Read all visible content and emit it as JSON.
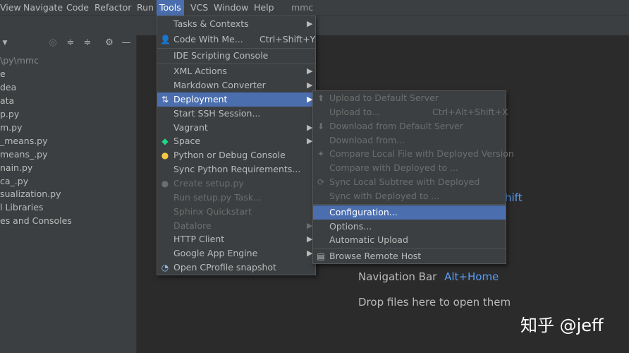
{
  "menubar": {
    "items": [
      "View",
      "Navigate",
      "Code",
      "Refactor",
      "Run",
      "Tools",
      "VCS",
      "Window",
      "Help"
    ],
    "project_name": "mmc"
  },
  "project_panel": {
    "path": "\\py\\mmc",
    "items": [
      "e",
      "dea",
      "ata",
      "p.py",
      "m.py",
      "_means.py",
      "means_.py",
      "nain.py",
      "ca_.py",
      "sualization.py",
      "l Libraries",
      "es and Consoles"
    ]
  },
  "editor_hints": {
    "hint1_suffix": "hift",
    "nav_label": "Navigation Bar",
    "nav_key": "Alt+Home",
    "drop_text": "Drop files here to open them"
  },
  "tools_menu": {
    "items": [
      {
        "label": "Tasks & Contexts",
        "submenu": true
      },
      {
        "label": "Code With Me...",
        "shortcut": "Ctrl+Shift+Y",
        "icon": "person-icon"
      },
      {
        "label": "IDE Scripting Console"
      },
      {
        "label": "XML Actions",
        "submenu": true
      },
      {
        "label": "Markdown Converter",
        "submenu": true
      },
      {
        "label": "Deployment",
        "submenu": true,
        "icon": "deployment-icon"
      },
      {
        "label": "Start SSH Session..."
      },
      {
        "label": "Vagrant",
        "submenu": true
      },
      {
        "label": "Space",
        "submenu": true,
        "icon": "space-icon"
      },
      {
        "label": "Python or Debug Console",
        "icon": "python-icon"
      },
      {
        "label": "Sync Python Requirements..."
      },
      {
        "label": "Create setup.py",
        "icon": "python-icon"
      },
      {
        "label": "Run setup.py Task..."
      },
      {
        "label": "Sphinx Quickstart"
      },
      {
        "label": "Datalore",
        "submenu": true
      },
      {
        "label": "HTTP Client",
        "submenu": true
      },
      {
        "label": "Google App Engine",
        "submenu": true
      },
      {
        "label": "Open CProfile snapshot",
        "icon": "profiler-icon"
      }
    ]
  },
  "deployment_menu": {
    "items": [
      {
        "label": "Upload to Default Server",
        "icon": "upload-icon"
      },
      {
        "label": "Upload to...",
        "shortcut": "Ctrl+Alt+Shift+X"
      },
      {
        "label": "Download from Default Server",
        "icon": "download-icon"
      },
      {
        "label": "Download from..."
      },
      {
        "label": "Compare Local File with Deployed Version",
        "icon": "compare-icon"
      },
      {
        "label": "Compare with Deployed to ..."
      },
      {
        "label": "Sync Local Subtree with Deployed",
        "icon": "sync-icon"
      },
      {
        "label": "Sync with Deployed to ..."
      },
      {
        "label": "Configuration..."
      },
      {
        "label": "Options..."
      },
      {
        "label": "Automatic Upload"
      },
      {
        "label": "Browse Remote Host",
        "icon": "server-icon"
      }
    ]
  },
  "watermark": "知乎 @jeff"
}
